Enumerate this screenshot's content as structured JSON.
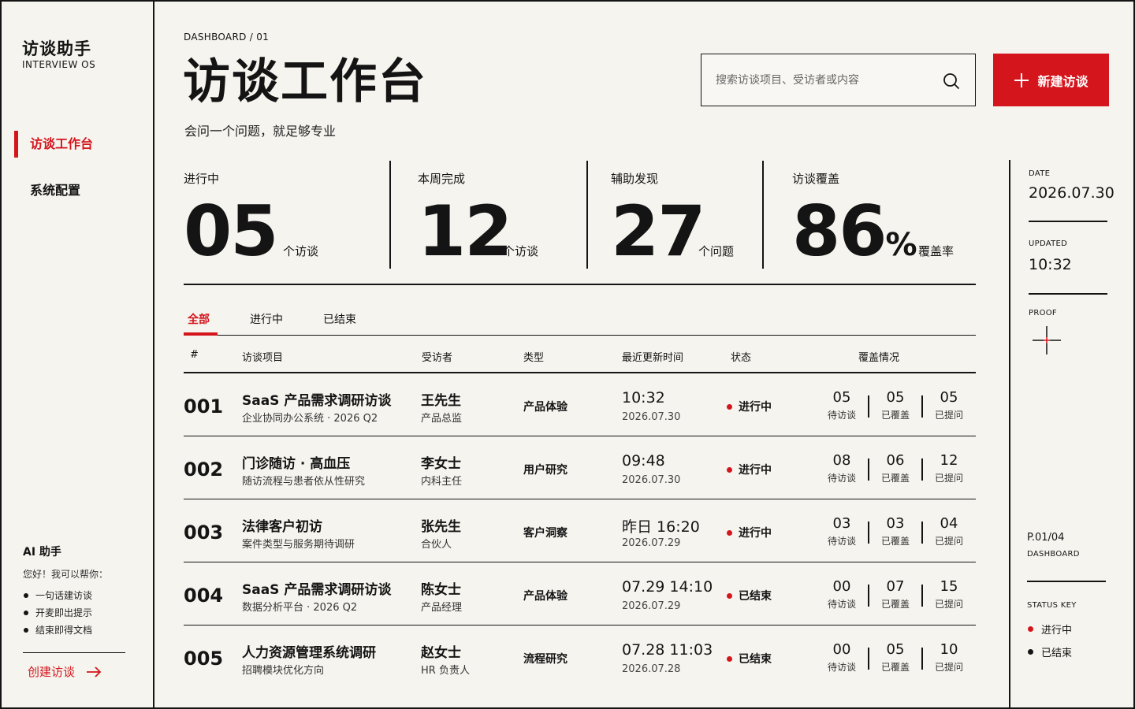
{
  "brand": {
    "title": "访谈助手",
    "subtitle": "INTERVIEW OS"
  },
  "sidebar": {
    "items": [
      {
        "label": "访谈工作台",
        "active": true
      },
      {
        "label": "系统配置",
        "active": false
      }
    ],
    "ai": {
      "title": "AI 助手",
      "greeting": "您好！我可以帮你：",
      "items": [
        "一句话建访谈",
        "开麦即出提示",
        "结束即得文档"
      ]
    },
    "create_label": "创建访谈"
  },
  "header": {
    "breadcrumb": "DASHBOARD  /  01",
    "title": "访谈工作台",
    "subtitle": "会问一个问题，就足够专业",
    "search_placeholder": "搜索访谈项目、受访者或内容",
    "new_button": "新建访谈"
  },
  "stats": [
    {
      "label": "进行中",
      "value": "05",
      "unit": "个访谈"
    },
    {
      "label": "本周完成",
      "value": "12",
      "unit": "个访谈"
    },
    {
      "label": "辅助发现",
      "value": "27",
      "unit": "个问题"
    },
    {
      "label": "访谈覆盖",
      "value": "86",
      "suffix": "%",
      "unit": "覆盖率"
    }
  ],
  "tabs": [
    {
      "label": "全部",
      "active": true
    },
    {
      "label": "进行中",
      "active": false
    },
    {
      "label": "已结束",
      "active": false
    }
  ],
  "table": {
    "headers": [
      "#",
      "访谈项目",
      "受访者",
      "类型",
      "最近更新时间",
      "状态",
      "覆盖情况"
    ],
    "coverage_labels": [
      "待访谈",
      "已覆盖",
      "已提问"
    ],
    "rows": [
      {
        "num": "001",
        "title": "SaaS 产品需求调研访谈",
        "sub": "企业协同办公系统 · 2026 Q2",
        "name": "王先生",
        "role": "产品总监",
        "type": "产品体验",
        "time": "10:32",
        "date": "2026.07.30",
        "status": "进行中",
        "cov": [
          "05",
          "05",
          "05"
        ]
      },
      {
        "num": "002",
        "title": "门诊随访 · 高血压",
        "sub": "随访流程与患者依从性研究",
        "name": "李女士",
        "role": "内科主任",
        "type": "用户研究",
        "time": "09:48",
        "date": "2026.07.30",
        "status": "进行中",
        "cov": [
          "08",
          "06",
          "12"
        ]
      },
      {
        "num": "003",
        "title": "法律客户初访",
        "sub": "案件类型与服务期待调研",
        "name": "张先生",
        "role": "合伙人",
        "type": "客户洞察",
        "time": "昨日  16:20",
        "date": "2026.07.29",
        "status": "进行中",
        "cov": [
          "03",
          "03",
          "04"
        ]
      },
      {
        "num": "004",
        "title": "SaaS 产品需求调研访谈",
        "sub": "数据分析平台 · 2026 Q2",
        "name": "陈女士",
        "role": "产品经理",
        "type": "产品体验",
        "time": "07.29 14:10",
        "date": "2026.07.29",
        "status": "已结束",
        "cov": [
          "00",
          "07",
          "15"
        ]
      },
      {
        "num": "005",
        "title": "人力资源管理系统调研",
        "sub": "招聘模块优化方向",
        "name": "赵女士",
        "role": "HR 负责人",
        "type": "流程研究",
        "time": "07.28 11:03",
        "date": "2026.07.28",
        "status": "已结束",
        "cov": [
          "00",
          "05",
          "10"
        ]
      }
    ]
  },
  "rail": {
    "date_label": "DATE",
    "date_value": "2026.07.30",
    "updated_label": "UPDATED",
    "updated_value": "10:32",
    "proof_label": "PROOF",
    "page": "P.01/04",
    "page_label": "DASHBOARD",
    "key_label": "STATUS KEY",
    "key_items": [
      "进行中",
      "已结束"
    ]
  },
  "colors": {
    "accent": "#d4151c",
    "ink": "#141414",
    "paper": "#f5f4ef"
  },
  "icons": {
    "search": "search-icon",
    "plus": "plus-icon",
    "arrow": "arrow-right-icon",
    "proof": "crosshair-icon"
  }
}
